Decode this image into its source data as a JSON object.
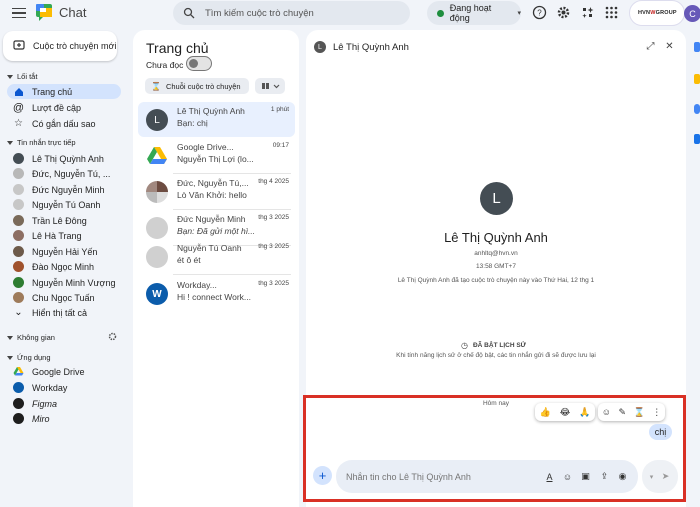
{
  "app": {
    "title": "Chat"
  },
  "search": {
    "placeholder": "Tìm kiếm cuộc trò chuyện"
  },
  "status": {
    "label": "Đang hoạt động",
    "color": "#1e8e3e"
  },
  "brand": {
    "text_prefix": "HVN",
    "text_mid": "W",
    "text_suffix": " GROUP"
  },
  "account": {
    "initial": "C"
  },
  "sidebar": {
    "new_chat_label": "Cuộc trò chuyện mới",
    "shortcuts_header": "Lối tắt",
    "shortcuts": [
      {
        "label": "Trang chủ",
        "icon": "home-icon"
      },
      {
        "label": "Lượt đề cập",
        "icon": "at-icon"
      },
      {
        "label": "Có gắn dấu sao",
        "icon": "star-icon"
      }
    ],
    "dm_header": "Tin nhắn trực tiếp",
    "dms": [
      {
        "label": "Lê Thị Quỳnh Anh"
      },
      {
        "label": "Đức, Nguyễn Tú, ..."
      },
      {
        "label": "Đức Nguyễn Minh"
      },
      {
        "label": "Nguyễn Tú Oanh"
      },
      {
        "label": "Trần Lê Đông"
      },
      {
        "label": "Lê Hà Trang"
      },
      {
        "label": "Nguyễn Hải Yến"
      },
      {
        "label": "Đào Ngọc Minh"
      },
      {
        "label": "Nguyễn Minh Vượng"
      },
      {
        "label": "Chu Ngọc Tuấn"
      }
    ],
    "show_all_label": "Hiển thị tất cả",
    "spaces_header": "Không gian",
    "apps_header": "Ứng dụng",
    "apps": [
      {
        "label": "Google Drive"
      },
      {
        "label": "Workday"
      },
      {
        "label": "Figma"
      },
      {
        "label": "Miro"
      }
    ]
  },
  "home": {
    "title": "Trang chủ",
    "unread_label": "Chưa đọc",
    "filter_label": "Chuỗi cuộc trò chuyện",
    "conversations": [
      {
        "name": "Lê Thị Quỳnh Anh",
        "snippet": "Bạn: chị",
        "time": "1 phút"
      },
      {
        "name": "Google Drive...",
        "snippet": "Nguyễn Thị Lợi (lo...",
        "time": "09:17"
      },
      {
        "name": "Đức, Nguyễn Tú,...",
        "snippet": "Lò Văn Khởi: hello",
        "time": "thg 4 2025"
      },
      {
        "name": "Đức Nguyễn Minh",
        "snippet": "Bạn: Đã gửi một hì...",
        "time": "thg 3 2025"
      },
      {
        "name": "Nguyễn Tú Oanh",
        "snippet": "ét ô ét",
        "time": "thg 3 2025"
      },
      {
        "name": "Workday...",
        "snippet": "Hi ! connect Work...",
        "time": "thg 3 2025"
      }
    ]
  },
  "chat": {
    "contact_name": "Lê Thị Quỳnh Anh",
    "contact_initial": "L",
    "email": "anhltq@hvn.vn",
    "time": "13:58 GMT+7",
    "created_text": "Lê Thị Quỳnh Anh đã tạo cuộc trò chuyện này vào Thứ Hai, 12 thg 1",
    "history_title": "ĐÃ BẬT LỊCH SỬ",
    "history_sub": "Khi tính năng lịch sử ở chế độ bật, các tin nhắn gửi đi sẽ được lưu lại",
    "today_label": "Hôm nay",
    "reactions": [
      "👍",
      "😂",
      "🙏"
    ],
    "message": "chị",
    "composer_placeholder": "Nhắn tin cho Lê Thị Quỳnh Anh"
  },
  "colors": {
    "accent": "#0b57d0",
    "highlight": "#d3e3fd",
    "frame": "#d93025"
  }
}
